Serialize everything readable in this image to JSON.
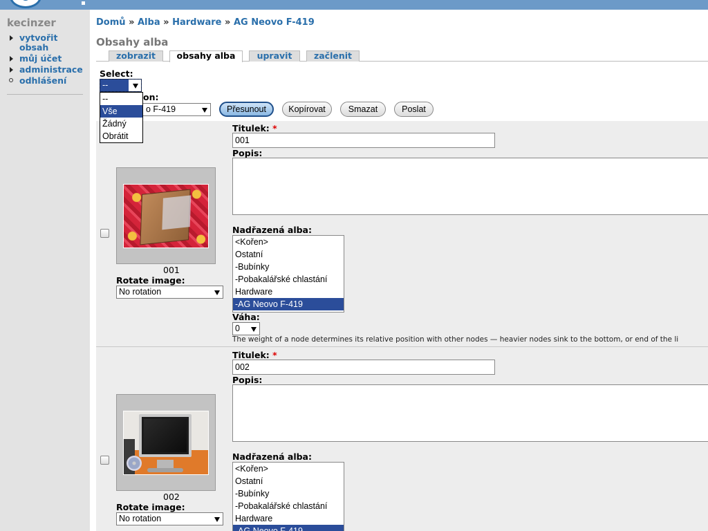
{
  "sidebar": {
    "username": "kecinzer",
    "items": [
      {
        "label": "vytvořit obsah",
        "bullet": "triangle"
      },
      {
        "label": "můj účet",
        "bullet": "triangle"
      },
      {
        "label": "administrace",
        "bullet": "triangle"
      },
      {
        "label": "odhlášení",
        "bullet": "circle"
      }
    ]
  },
  "breadcrumb": {
    "items": [
      "Domů",
      "Alba",
      "Hardware",
      "AG Neovo F-419"
    ],
    "separator": "»"
  },
  "page_title": "Obsahy alba",
  "tabs": [
    {
      "label": "zobrazit",
      "active": false
    },
    {
      "label": "obsahy alba",
      "active": true
    },
    {
      "label": "upravit",
      "active": false
    },
    {
      "label": "začlenit",
      "active": false
    }
  ],
  "select": {
    "label": "Select:",
    "value": "--",
    "options": [
      "--",
      "Vše",
      "Žádný",
      "Obrátit"
    ],
    "highlighted": "Vše"
  },
  "action": {
    "label_partial": "on:",
    "album_value_partial": "o F-419"
  },
  "buttons": {
    "move": "Přesunout",
    "copy": "Kopírovat",
    "delete": "Smazat",
    "send": "Poslat"
  },
  "form_labels": {
    "title": "Titulek:",
    "required_mark": "*",
    "description": "Popis:",
    "parent_albums": "Nadřazená alba:",
    "rotate": "Rotate image:",
    "weight": "Váha:",
    "weight_help": "The weight of a node determines its relative position with other nodes — heavier nodes sink to the bottom, or end of the li"
  },
  "album_options": [
    "<Kořen>",
    "Ostatní",
    "-Bubínky",
    "-Pobakalářské chlastání",
    "Hardware",
    "-AG Neovo F-419"
  ],
  "items": [
    {
      "caption": "001",
      "title": "001",
      "rotation": "No rotation",
      "selected_album": "-AG Neovo F-419",
      "weight": "0",
      "photo_icon": "box-on-carpet"
    },
    {
      "caption": "002",
      "title": "002",
      "rotation": "No rotation",
      "selected_album": "-AG Neovo F-419",
      "photo_icon": "lcd-monitor"
    }
  ],
  "colors": {
    "link": "#2a6fab",
    "header": "#6c9ac8",
    "selection": "#2b4d9a",
    "row_bg": "#ededed"
  }
}
